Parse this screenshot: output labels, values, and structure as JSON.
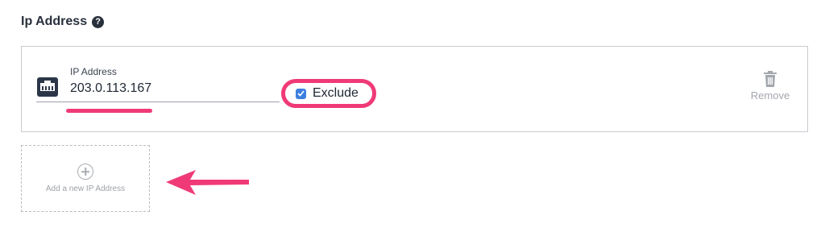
{
  "section": {
    "title": "Ip Address",
    "help_icon": "question-circle-icon",
    "help_glyph": "?"
  },
  "ip_entry": {
    "icon": "network-port-icon",
    "label": "IP Address",
    "value": "203.0.113.167",
    "exclude": {
      "label": "Exclude",
      "checked": true
    },
    "remove": {
      "icon": "trash-icon",
      "label": "Remove"
    }
  },
  "add_new": {
    "icon": "plus-circle-icon",
    "label": "Add a new IP Address"
  },
  "annotation": {
    "highlight_color": "#f03a78",
    "arrow_icon": "pointer-arrow-icon"
  },
  "colors": {
    "checkbox": "#3d7fe0",
    "text_dark": "#28303c",
    "muted": "#a3a7ad"
  }
}
